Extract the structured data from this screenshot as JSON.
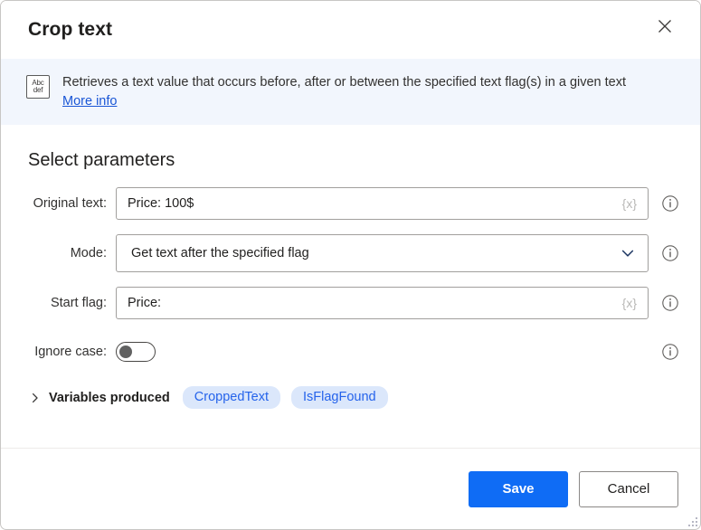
{
  "window": {
    "title": "Crop text",
    "close_label": "Close"
  },
  "banner": {
    "icon": "abc-def-text-icon",
    "icon_line1": "Abc",
    "icon_line2": "def",
    "description": "Retrieves a text value that occurs before, after or between the specified text flag(s) in a given text",
    "link_label": "More info"
  },
  "content": {
    "section_heading": "Select parameters",
    "fields": [
      {
        "label": "Original text:",
        "type": "textbox",
        "value": "Price: 100$",
        "placeholder": "",
        "var_token": "{x}",
        "info": "info-icon"
      },
      {
        "label": "Mode:",
        "type": "dropdown",
        "value": "Get text after the specified flag",
        "info": "info-icon"
      },
      {
        "label": "Start flag:",
        "type": "textbox",
        "value": "Price:",
        "placeholder": "",
        "var_token": "{x}",
        "info": "info-icon"
      },
      {
        "label": "Ignore case:",
        "type": "toggle",
        "state": "off",
        "info": "info-icon"
      }
    ],
    "variables_produced": {
      "label": "Variables produced",
      "expanded": false,
      "pills": [
        "CroppedText",
        "IsFlagFound"
      ]
    }
  },
  "footer": {
    "save_label": "Save",
    "cancel_label": "Cancel"
  },
  "colors": {
    "accent": "#0f6cf5",
    "banner_bg": "#f2f6fd",
    "link": "#1a56d6",
    "pill_bg": "#dbe7fb",
    "pill_text": "#2563eb"
  }
}
